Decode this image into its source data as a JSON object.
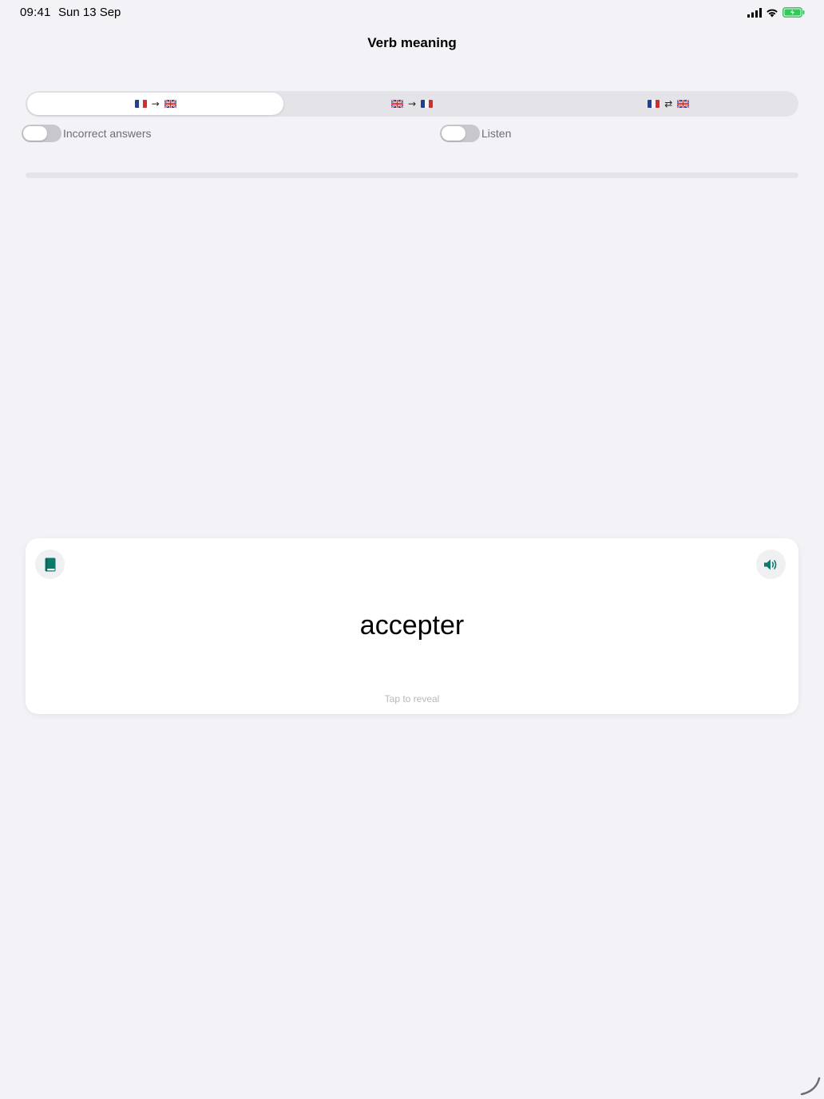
{
  "status_bar": {
    "time": "09:41",
    "date": "Sun 13 Sep"
  },
  "nav": {
    "title": "Verb meaning"
  },
  "direction_tabs": [
    {
      "from": "fr-flag-icon",
      "arrow": "→",
      "to": "uk-flag-icon",
      "selected": true
    },
    {
      "from": "uk-flag-icon",
      "arrow": "→",
      "to": "fr-flag-icon",
      "selected": false
    },
    {
      "from": "fr-flag-icon",
      "arrow": "⇄",
      "to": "uk-flag-icon",
      "selected": false
    }
  ],
  "toggles": {
    "incorrect_answers": {
      "label": "Incorrect answers",
      "on": false
    },
    "listen": {
      "label": "Listen",
      "on": false
    }
  },
  "progress": {
    "fraction": 0
  },
  "card": {
    "word": "accepter",
    "hint": "Tap to reveal",
    "left_icon": "book-icon",
    "right_icon": "speaker-icon"
  },
  "colors": {
    "accent": "#0a7a6b",
    "background": "#f2f2f7",
    "battery": "#34c759"
  }
}
